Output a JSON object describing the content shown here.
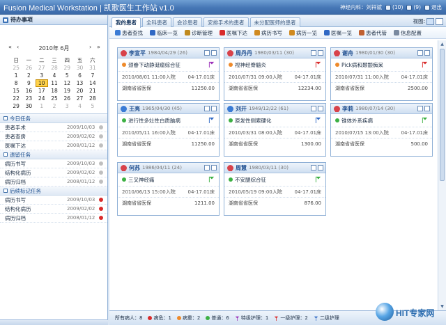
{
  "app": {
    "title": "Fusion Medical Workstation | 凯歌医生工作站 v1.0",
    "user": "神经内科：刘祥斌",
    "messages": "(10)",
    "lab": "(9)",
    "exit": "退出"
  },
  "left": {
    "header": "待办事项",
    "calendar": {
      "month": "2010年 6月",
      "weekdays": [
        "日",
        "一",
        "二",
        "三",
        "四",
        "五",
        "六"
      ],
      "weeks": [
        [
          "25",
          "26",
          "27",
          "28",
          "29",
          "30",
          "31"
        ],
        [
          "1",
          "2",
          "3",
          "4",
          "5",
          "6",
          "7"
        ],
        [
          "8",
          "9",
          "10",
          "11",
          "12",
          "13",
          "14"
        ],
        [
          "15",
          "16",
          "17",
          "18",
          "19",
          "20",
          "21"
        ],
        [
          "22",
          "23",
          "24",
          "25",
          "26",
          "27",
          "28"
        ],
        [
          "29",
          "30",
          "1",
          "2",
          "3",
          "4",
          "5"
        ]
      ],
      "today_index": [
        2,
        2
      ]
    },
    "groups": [
      {
        "title": "今日任务",
        "items": [
          {
            "name": "患者手术",
            "date": "2009/10/03"
          },
          {
            "name": "患者查房",
            "date": "2009/02/02"
          },
          {
            "name": "医嘱下达",
            "date": "2008/01/12"
          }
        ]
      },
      {
        "title": "遗留任务",
        "items": [
          {
            "name": "病历书写",
            "date": "2009/10/03"
          },
          {
            "name": "结构化病历",
            "date": "2009/02/02"
          },
          {
            "name": "病历归档",
            "date": "2008/01/12"
          }
        ]
      },
      {
        "title": "后续标记任务",
        "items": [
          {
            "name": "病历书写",
            "date": "2009/10/03"
          },
          {
            "name": "结构化病历",
            "date": "2009/02/02"
          },
          {
            "name": "病历归档",
            "date": "2008/01/12"
          }
        ]
      }
    ]
  },
  "tabs": [
    "我的患者",
    "全科患者",
    "会诊患者",
    "安排手术的患者",
    "未分配医师的患者"
  ],
  "view_label": "视图:",
  "toolbar": [
    "患者查找",
    "临床一览",
    "诊断管理",
    "医嘱下达",
    "病历书写",
    "病历一览",
    "医嘱一览",
    "患者代管",
    "信息配置"
  ],
  "patients": [
    {
      "name": "李宣平",
      "info": "1984/04/29 (26)",
      "diag": "颈眷下动静涎瘤综合征",
      "admit": "2010/08/01 11:00入院",
      "bed": "04-17.01床",
      "ins": "湖南省省医保",
      "amt": "11250.00",
      "gender": "f",
      "status": "orange",
      "flag": "purple"
    },
    {
      "name": "周丹丹",
      "info": "1980/03/11 (30)",
      "diag": "视神经脊髓炎",
      "admit": "2010/07/31 09:00入院",
      "bed": "04-17.01床",
      "ins": "湖南省省医保",
      "amt": "12234.00",
      "gender": "f",
      "status": "orange",
      "flag": "red"
    },
    {
      "name": "谢舟",
      "info": "1980/01/30 (30)",
      "diag": "Pick病和颞颥痴呆",
      "admit": "2010/07/31 11:00入院",
      "bed": "04-17.01床",
      "ins": "湖南省省医保",
      "amt": "2500.00",
      "gender": "f",
      "status": "orange",
      "flag": "red"
    },
    {
      "name": "王亮",
      "info": "1965/04/30 (45)",
      "diag": "进行性多灶性白质脑病",
      "admit": "2010/05/11 16:00入院",
      "bed": "04-17.01床",
      "ins": "湖南省省医保",
      "amt": "11250.00",
      "gender": "m",
      "status": "green",
      "flag": "blue"
    },
    {
      "name": "刘开",
      "info": "1949/12/22 (61)",
      "diag": "原发性侧索硬化",
      "admit": "2010/03/31 08:00入院",
      "bed": "04-17.01床",
      "ins": "湖南省省医保",
      "amt": "1300.00",
      "gender": "m",
      "status": "green",
      "flag": "blue"
    },
    {
      "name": "李莉",
      "info": "1980/07/14 (30)",
      "diag": "锥体外系疾病",
      "admit": "2010/07/15 13:00入院",
      "bed": "04-17.01床",
      "ins": "湖南省省医保",
      "amt": "500.00",
      "gender": "f",
      "status": "green",
      "flag": "green"
    },
    {
      "name": "何苏",
      "info": "1986/04/11 (24)",
      "diag": "三叉神经痛",
      "admit": "2010/06/13 15:00入院",
      "bed": "04-17.01床",
      "ins": "湖南省省医保",
      "amt": "1211.00",
      "gender": "f",
      "status": "green",
      "flag": "green"
    },
    {
      "name": "周慧",
      "info": "1980/03/11 (30)",
      "diag": "不安腿综合征",
      "admit": "2010/05/19 09:00入院",
      "bed": "04-17.01床",
      "ins": "湖南省省医保",
      "amt": "876.00",
      "gender": "f",
      "status": "green",
      "flag": "green"
    }
  ],
  "status": {
    "total": "所有病人：8",
    "critical": "病危：1",
    "serious": "病重：2",
    "normal": "普通：6",
    "special_care": "特级护理：1",
    "first_care": "一级护理：2",
    "second_care": "二级护理"
  },
  "watermark": "HIT专家网",
  "colors": {
    "orange": "#ee8a2a",
    "green": "#3cb043",
    "red": "#d92b2b",
    "purple": "#9b2fb8",
    "blue": "#2f68c4",
    "female": "#d8424a",
    "male": "#3a7bd5"
  }
}
